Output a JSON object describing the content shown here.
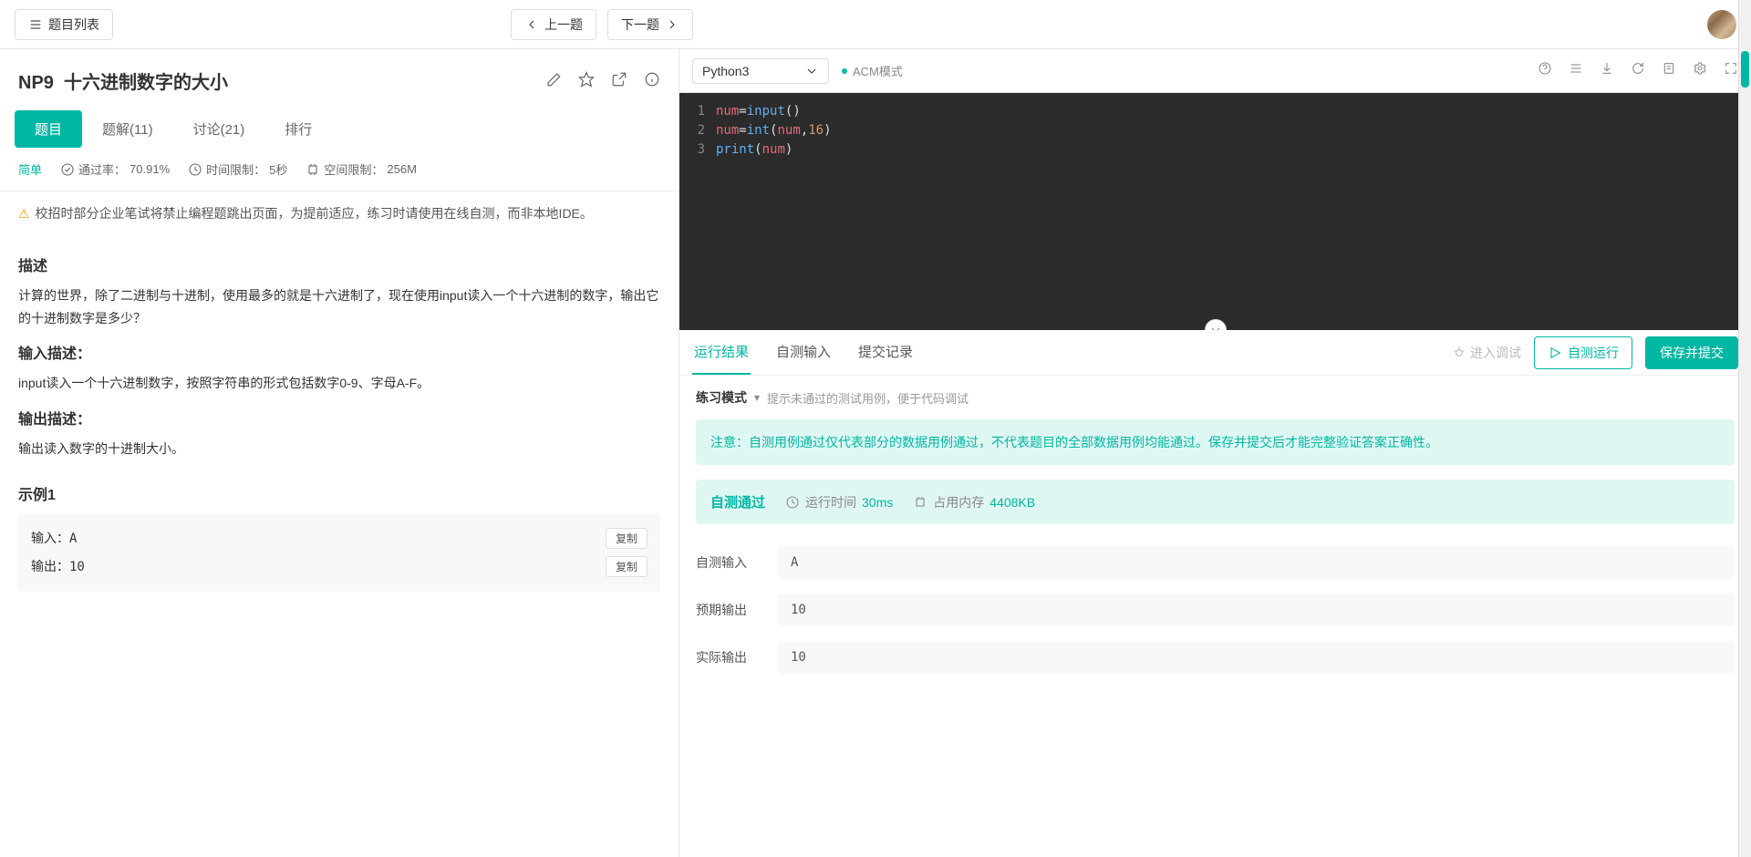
{
  "topbar": {
    "list_btn": "题目列表",
    "prev_btn": "上一题",
    "next_btn": "下一题"
  },
  "problem": {
    "id": "NP9",
    "title": "十六进制数字的大小",
    "tabs": {
      "problem": "题目",
      "solution": "题解(11)",
      "discuss": "讨论(21)",
      "rank": "排行"
    },
    "difficulty": "简单",
    "pass_rate_label": "通过率：",
    "pass_rate": "70.91%",
    "time_limit_label": "时间限制：",
    "time_limit": "5秒",
    "mem_limit_label": "空间限制：",
    "mem_limit": "256M",
    "warning": "校招时部分企业笔试将禁止编程题跳出页面，为提前适应，练习时请使用在线自测，而非本地IDE。",
    "desc_h": "描述",
    "desc": "计算的世界，除了二进制与十进制，使用最多的就是十六进制了，现在使用input读入一个十六进制的数字，输出它的十进制数字是多少？",
    "input_h": "输入描述：",
    "input_desc": "input读入一个十六进制数字，按照字符串的形式包括数字0-9、字母A-F。",
    "output_h": "输出描述：",
    "output_desc": "输出读入数字的十进制大小。",
    "example_h": "示例1",
    "example_in_label": "输入：",
    "example_in": "A",
    "example_out_label": "输出：",
    "example_out": "10",
    "copy": "复制"
  },
  "editor": {
    "language": "Python3",
    "mode": "ACM模式",
    "code_lines": [
      "num=input()",
      "num=int(num,16)",
      "print(num)"
    ]
  },
  "result": {
    "tabs": {
      "run": "运行结果",
      "self": "自测输入",
      "history": "提交记录"
    },
    "debug": "进入调试",
    "test_btn": "自测运行",
    "submit_btn": "保存并提交",
    "practice_label": "练习模式",
    "practice_hint": "提示未通过的测试用例，便于代码调试",
    "notice": "注意：自测用例通过仅代表部分的数据用例通过，不代表题目的全部数据用例均能通过。保存并提交后才能完整验证答案正确性。",
    "status": "自测通过",
    "time_label": "运行时间",
    "time_val": "30ms",
    "mem_label": "占用内存",
    "mem_val": "4408KB",
    "io_in_label": "自测输入",
    "io_in": "A",
    "io_exp_label": "预期输出",
    "io_exp": "10",
    "io_act_label": "实际输出",
    "io_act": "10"
  }
}
